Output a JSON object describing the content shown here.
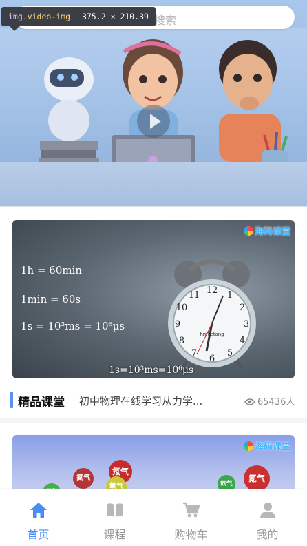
{
  "search": {
    "placeholder": "搜索"
  },
  "dev_tooltip": {
    "tag": "img",
    "class": ".video-img",
    "size": "375.2 × 210.39"
  },
  "hero": {
    "play_icon": "play-icon"
  },
  "courses": [
    {
      "brand": "海码课堂",
      "formulas": [
        "1h = 60min",
        "1min = 60s",
        "1s = 10³ms = 10⁶μs"
      ],
      "bottom_caption": "1s=10³ms=10⁶μs",
      "clock_brand": "hmketang",
      "title": "精品课堂",
      "description": "初中物理在线学习从力学...",
      "views": "65436人"
    },
    {
      "brand": "海码课堂",
      "balls": [
        "氦气",
        "氖气",
        "氩气",
        "氙气",
        "氪气",
        "氧气"
      ]
    }
  ],
  "tabbar": {
    "items": [
      {
        "label": "首页",
        "icon": "home-icon",
        "active": true
      },
      {
        "label": "课程",
        "icon": "book-icon",
        "active": false
      },
      {
        "label": "购物车",
        "icon": "cart-icon",
        "active": false
      },
      {
        "label": "我的",
        "icon": "user-icon",
        "active": false
      }
    ]
  },
  "colors": {
    "accent": "#4a8df0",
    "inactive": "#999999"
  }
}
